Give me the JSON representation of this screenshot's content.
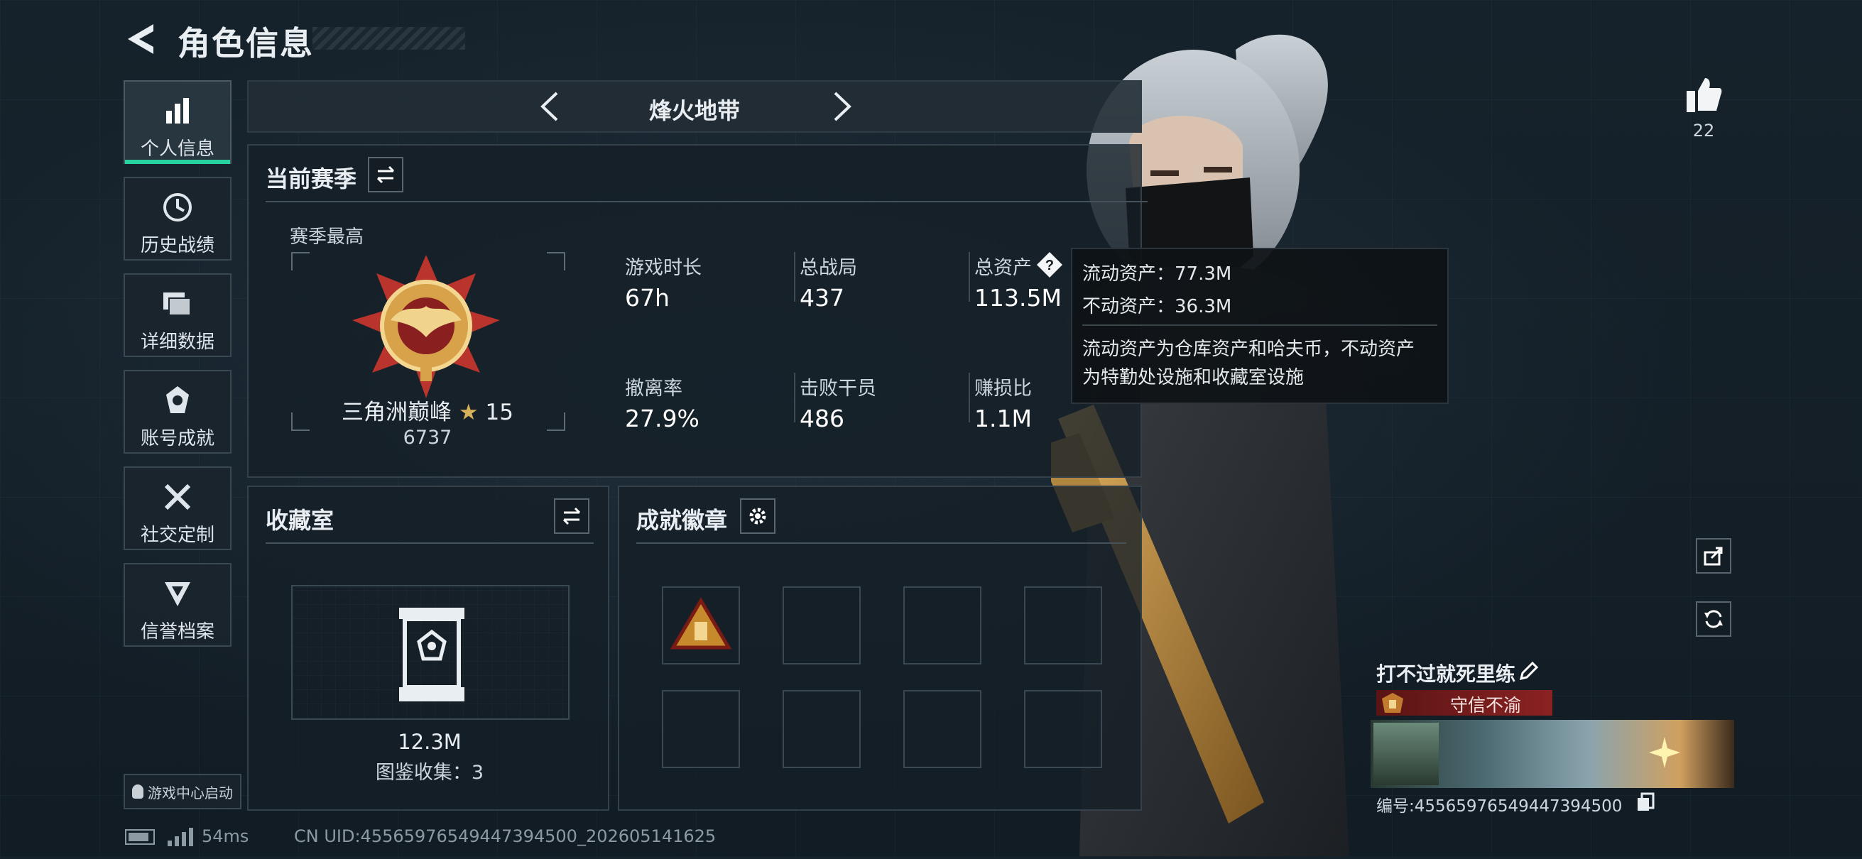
{
  "header": {
    "title": "角色信息"
  },
  "sidebar": {
    "items": [
      {
        "label": "个人信息",
        "icon": "bar-chart-icon"
      },
      {
        "label": "历史战绩",
        "icon": "clock-icon"
      },
      {
        "label": "详细数据",
        "icon": "folders-icon"
      },
      {
        "label": "账号成就",
        "icon": "achievement-icon"
      },
      {
        "label": "社交定制",
        "icon": "tools-icon"
      },
      {
        "label": "信誉档案",
        "icon": "shield-rank-icon"
      }
    ],
    "game_center": "游戏中心启动"
  },
  "mode_tab": {
    "title": "烽火地带"
  },
  "season": {
    "title": "当前赛季",
    "best_label": "赛季最高",
    "rank_name": "三角洲巅峰",
    "rank_stars": "15",
    "rank_score": "6737",
    "stats": [
      {
        "label": "游戏时长",
        "value": "67h"
      },
      {
        "label": "总战局",
        "value": "437"
      },
      {
        "label": "总资产",
        "value": "113.5M"
      },
      {
        "label": "撤离率",
        "value": "27.9%"
      },
      {
        "label": "击败干员",
        "value": "486"
      },
      {
        "label": "赚损比",
        "value": "1.1M"
      }
    ]
  },
  "tooltip": {
    "liquid": "流动资产：77.3M",
    "fixed": "不动资产：36.3M",
    "desc_line1": "流动资产为仓库资产和哈夫币，不动资产",
    "desc_line2": "为特勤处设施和收藏室设施"
  },
  "collection": {
    "title": "收藏室",
    "value": "12.3M",
    "count": "图鉴收集：3"
  },
  "badges": {
    "title": "成就徽章"
  },
  "likes": {
    "count": "22"
  },
  "player": {
    "name": "打不过就死里练",
    "credit": "守信不渝",
    "id": "编号:4556597654944739450​0"
  },
  "status": {
    "ping": "54ms",
    "uid": "CN UID:45565976549447394500_202605141625"
  },
  "colors": {
    "accent": "#26d3a0",
    "credit_red": "#7a1a1a",
    "gold": "#d7a24a"
  }
}
